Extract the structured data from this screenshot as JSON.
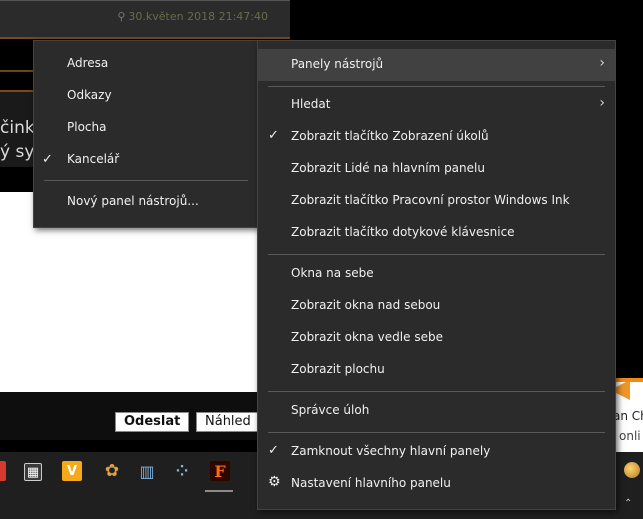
{
  "background": {
    "post_date": "30.květen 2018 21:47:40",
    "post_text_1": "činky",
    "post_text_2": "ý sys",
    "send_button": "Odeslat",
    "preview_button": "Náhled",
    "toast_line1": "an Ch",
    "toast_line2": "onli"
  },
  "submenu": {
    "items": [
      {
        "label": "Adresa",
        "checked": false
      },
      {
        "label": "Odkazy",
        "checked": false
      },
      {
        "label": "Plocha",
        "checked": false
      },
      {
        "label": "Kancelář",
        "checked": true
      }
    ],
    "new_toolbar": "Nový panel nástrojů..."
  },
  "menu": {
    "toolbars": "Panely nástrojů",
    "search": "Hledat",
    "show_task_view": "Zobrazit tlačítko Zobrazení úkolů",
    "show_people": "Zobrazit Lidé na hlavním panelu",
    "show_ink": "Zobrazit tlačítko Pracovní prostor Windows Ink",
    "show_keyboard": "Zobrazit tlačítko dotykové klávesnice",
    "cascade": "Okna na sebe",
    "stack": "Zobrazit okna nad sebou",
    "side_by_side": "Zobrazit okna vedle sebe",
    "show_desktop": "Zobrazit plochu",
    "task_manager": "Správce úloh",
    "lock_taskbars": "Zamknout všechny hlavní panely",
    "taskbar_settings": "Nastavení hlavního panelu"
  },
  "glyphs": {
    "check": "✓",
    "chevron": "›",
    "gear": "⚙"
  },
  "taskbar_icons": [
    "app-red-icon",
    "store-icon",
    "vivaldi-icon",
    "paint-icon",
    "books-icon",
    "grid-icon",
    "f-app-icon"
  ]
}
